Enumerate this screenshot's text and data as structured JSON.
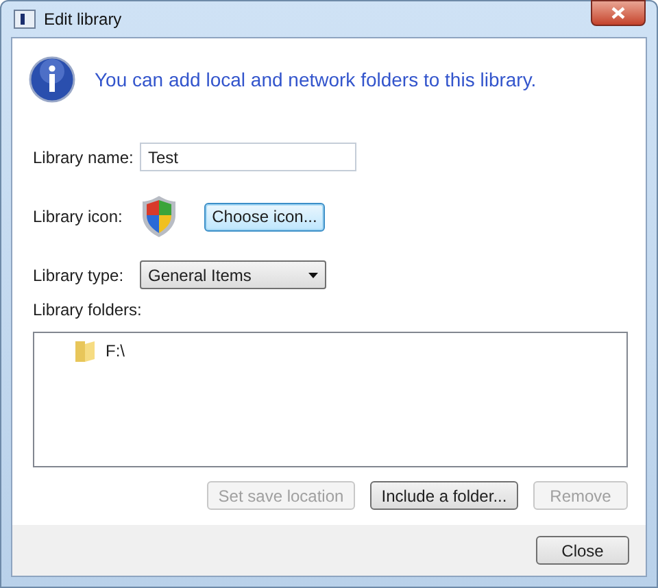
{
  "window": {
    "title": "Edit library"
  },
  "info": {
    "message": "You can add local and network folders to this library."
  },
  "name_field": {
    "label": "Library name:",
    "value": "Test"
  },
  "icon_row": {
    "label": "Library icon:",
    "button": {
      "label": "Choose icon...",
      "focused": true
    }
  },
  "type_field": {
    "label": "Library type:",
    "value": "General Items"
  },
  "folders": {
    "label": "Library folders:",
    "items": [
      {
        "path": "F:\\"
      }
    ]
  },
  "folder_buttons": [
    {
      "label": "Set save location",
      "disabled": true
    },
    {
      "label": "Include a folder...",
      "disabled": false
    },
    {
      "label": "Remove",
      "disabled": true
    }
  ],
  "footer_buttons": [
    {
      "label": "Close"
    }
  ]
}
